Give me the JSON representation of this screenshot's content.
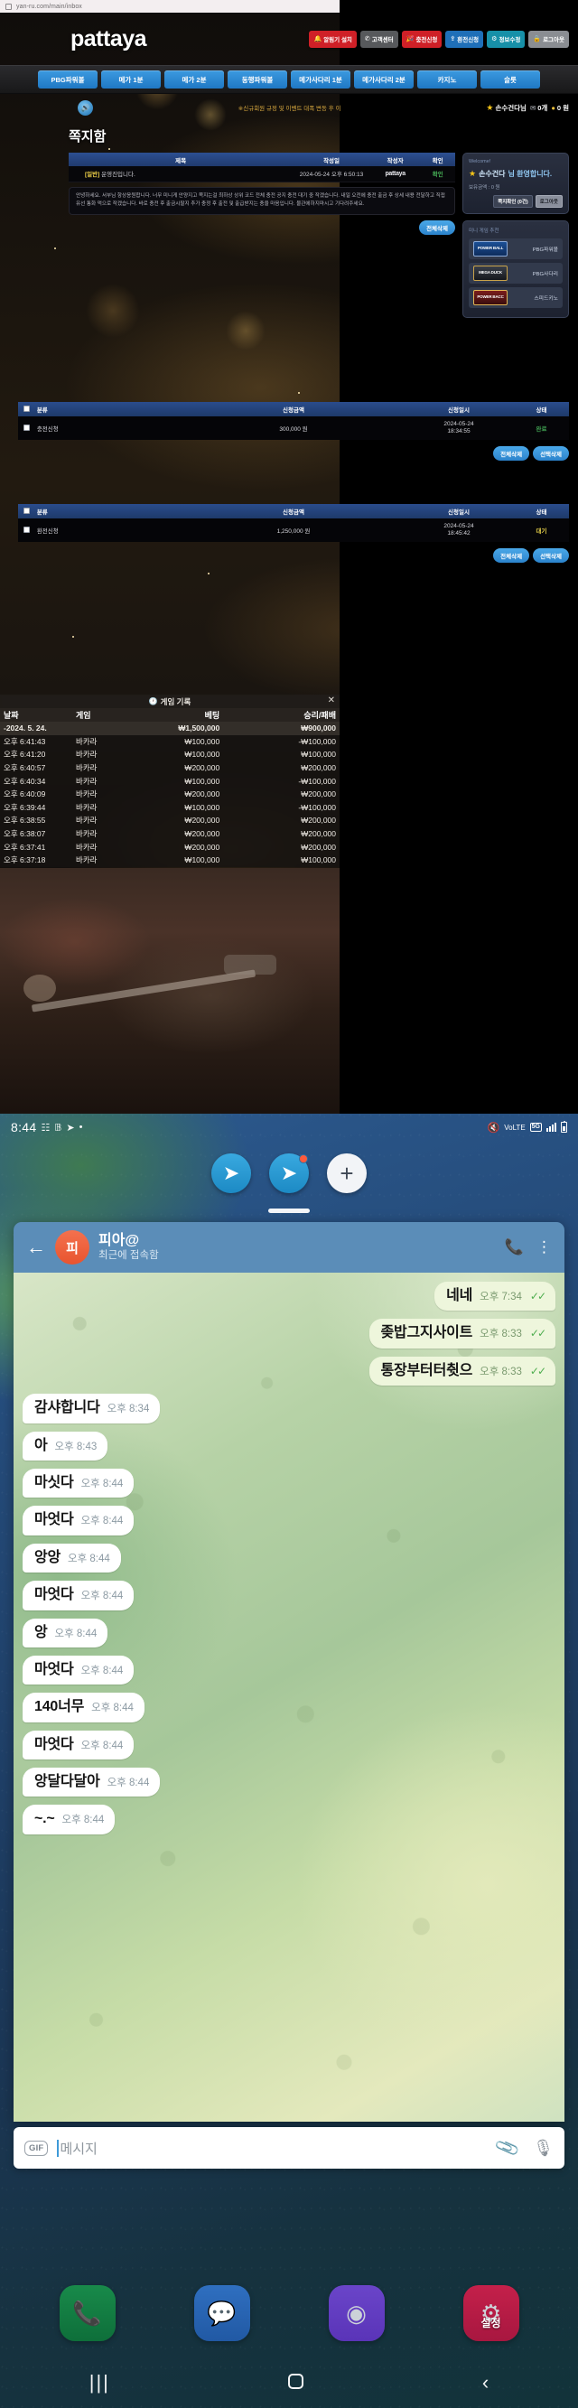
{
  "browser": {
    "url": "yan-ru.com/main/inbox",
    "lock_icon": "page-info-icon"
  },
  "casino_site": {
    "brand": "pattaya",
    "header_buttons": [
      {
        "label": "알림기 설치",
        "icon": "bell-icon",
        "color": "#cf2027"
      },
      {
        "label": "고객센터",
        "icon": "headset-icon",
        "color": "#57595c"
      },
      {
        "label": "충전신청",
        "icon": "coin-icon",
        "color": "#cf2027"
      },
      {
        "label": "환전신청",
        "icon": "upload-icon",
        "color": "#1f6fb8"
      },
      {
        "label": "정보수정",
        "icon": "user-gear-icon",
        "color": "#1790a8"
      },
      {
        "label": "로그아웃",
        "icon": "lock-icon",
        "color": "#8a8d92"
      }
    ],
    "nav_items": [
      "PBG파워볼",
      "메가 1분",
      "메가 2분",
      "동행파워볼",
      "메가사다리 1분",
      "메가사다리 2분",
      "카지노",
      "슬롯"
    ],
    "notice": "※신규회원 규정 및 이벤트 대폭 변동 후 이",
    "speaker_icon": "speaker-icon",
    "user_mini": {
      "star_icon": "star-icon",
      "nickname": "손수건다님",
      "mail_icon": "mail-icon",
      "mail_count": "0개",
      "coin_icon": "coin-icon",
      "balance": "0 원"
    },
    "page_title": "쪽지함",
    "inbox_table": {
      "headers": [
        "제목",
        "작성일",
        "작성자",
        "확인"
      ],
      "row": {
        "tag": "[일반]",
        "subject": "운영진입니다.",
        "date": "2024-05-24 오후 6:50:13",
        "author": "pattaya",
        "state": "확인"
      }
    },
    "inbox_body": "안녕하세요. 서부님 항상응원합니다. 너무 미니게 안양지고 쪽지는걸 최하상 상위 코드 전체 충전 공지 충전 대기 중 작겠습니다. 내일 오전에 충전 출금 후 상세 내용 전달하고 직접 유선 통화 먹으로 작겠습니다. 바로 충전 후 출금시팔지 추가 충정 후 출전 및 출급받지는 충을 마음입니다. 물관에하지마시고 기다려주세요.",
    "inbox_action": "전체삭제",
    "sidebar": {
      "welcome_label": "Welcome!",
      "welcome_star": "star-icon",
      "welcome_name": "손수건다",
      "welcome_suffix": "님 환영합니다.",
      "balance_label": "보유금액 : 0 원",
      "buttons": [
        "쪽지확인 (0건)",
        "로그아웃"
      ],
      "mini_title": "미니 게임 추천",
      "games": [
        {
          "logo": "POWER BALL",
          "name": "PBG파워볼"
        },
        {
          "logo": "MEGA DUCK",
          "name": "PBG사다리"
        },
        {
          "logo": "POWER BACC",
          "name": "스피드키노"
        }
      ]
    },
    "deposit_table": {
      "headers": [
        "분류",
        "신청금액",
        "신청일시",
        "상태"
      ],
      "rows": [
        {
          "type": "충전신청",
          "amount": "300,000 원",
          "date": "2024-05-24",
          "time": "18:34:55",
          "state": "완료",
          "state_kind": "done"
        }
      ],
      "actions": [
        "전체삭제",
        "선택삭제"
      ]
    },
    "withdraw_table": {
      "headers": [
        "분류",
        "신청금액",
        "신청일시",
        "상태"
      ],
      "rows": [
        {
          "type": "환전신청",
          "amount": "1,250,000 원",
          "date": "2024-05-24",
          "time": "18:45:42",
          "state": "대기",
          "state_kind": "wait"
        }
      ],
      "actions": [
        "전체삭제",
        "선택삭제"
      ]
    },
    "game_record": {
      "title": "게임 기록",
      "clock_icon": "clock-icon",
      "close_icon": "close-icon",
      "headers": [
        "날짜",
        "게임",
        "베팅",
        "승리/패배"
      ],
      "summary": {
        "date": "-2024. 5. 24.",
        "game": "",
        "bet": "₩1,500,000",
        "result": "₩900,000"
      },
      "rows": [
        {
          "date": "오후 6:41:43",
          "game": "바카라",
          "bet": "₩100,000",
          "result": "-₩100,000"
        },
        {
          "date": "오후 6:41:20",
          "game": "바카라",
          "bet": "₩100,000",
          "result": "₩100,000"
        },
        {
          "date": "오후 6:40:57",
          "game": "바카라",
          "bet": "₩200,000",
          "result": "₩200,000"
        },
        {
          "date": "오후 6:40:34",
          "game": "바카라",
          "bet": "₩100,000",
          "result": "-₩100,000"
        },
        {
          "date": "오후 6:40:09",
          "game": "바카라",
          "bet": "₩200,000",
          "result": "₩200,000"
        },
        {
          "date": "오후 6:39:44",
          "game": "바카라",
          "bet": "₩100,000",
          "result": "-₩100,000"
        },
        {
          "date": "오후 6:38:55",
          "game": "바카라",
          "bet": "₩200,000",
          "result": "₩200,000"
        },
        {
          "date": "오후 6:38:07",
          "game": "바카라",
          "bet": "₩200,000",
          "result": "₩200,000"
        },
        {
          "date": "오후 6:37:41",
          "game": "바카라",
          "bet": "₩200,000",
          "result": "₩200,000"
        },
        {
          "date": "오후 6:37:18",
          "game": "바카라",
          "bet": "₩100,000",
          "result": "₩100,000"
        }
      ]
    }
  },
  "phone": {
    "statusbar": {
      "time": "8:44",
      "left_icons": [
        "screenshot-icon",
        "bank-icon",
        "telegram-icon",
        "dot-icon"
      ],
      "mute_icon": "mute-icon",
      "vo_lte": "VoLTE",
      "network": "5G",
      "signal_icon": "signal-icon",
      "battery_icon": "battery-icon"
    },
    "top_dock": {
      "apps": [
        "telegram-icon",
        "telegram-icon",
        "add-icon"
      ],
      "add_label": "+"
    },
    "telegram": {
      "back_icon": "back-arrow-icon",
      "avatar_initial": "피",
      "title": "피아@",
      "subtitle": "최근에 접속함",
      "call_icon": "phone-icon",
      "menu_icon": "more-vertical-icon",
      "messages": [
        {
          "dir": "out",
          "text": "네네",
          "time": "오후 7:34",
          "ticks": "✓✓"
        },
        {
          "dir": "out",
          "text": "좆밥그지사이트",
          "time": "오후 8:33",
          "ticks": "✓✓"
        },
        {
          "dir": "out",
          "text": "통장부터터췻으",
          "time": "오후 8:33",
          "ticks": "✓✓"
        },
        {
          "dir": "in",
          "text": "감샤합니다",
          "time": "오후 8:34"
        },
        {
          "dir": "in",
          "text": "아",
          "time": "오후 8:43"
        },
        {
          "dir": "in",
          "text": "마싯다",
          "time": "오후 8:44"
        },
        {
          "dir": "in",
          "text": "마엇다",
          "time": "오후 8:44"
        },
        {
          "dir": "in",
          "text": "앙앙",
          "time": "오후 8:44"
        },
        {
          "dir": "in",
          "text": "마엇다",
          "time": "오후 8:44"
        },
        {
          "dir": "in",
          "text": "앙",
          "time": "오후 8:44"
        },
        {
          "dir": "in",
          "text": "마엇다",
          "time": "오후 8:44"
        },
        {
          "dir": "in",
          "text": "140너무",
          "time": "오후 8:44"
        },
        {
          "dir": "in",
          "text": "마엇다",
          "time": "오후 8:44"
        },
        {
          "dir": "in",
          "text": "앙달다달아",
          "time": "오후 8:44"
        },
        {
          "dir": "in",
          "text": "~.~",
          "time": "오후 8:44"
        }
      ],
      "input": {
        "gif_label": "GIF",
        "placeholder": "메시지",
        "attach_icon": "paperclip-icon",
        "mic_icon": "microphone-icon"
      }
    },
    "bottom_dock": [
      {
        "icon": "phone-icon",
        "label": ""
      },
      {
        "icon": "message-icon",
        "label": ""
      },
      {
        "icon": "gallery-icon",
        "label": ""
      },
      {
        "icon": "settings-icon",
        "label": "설정"
      }
    ],
    "nav": {
      "recents_icon": "recents-icon",
      "home_icon": "home-icon",
      "back_icon": "back-icon"
    }
  }
}
